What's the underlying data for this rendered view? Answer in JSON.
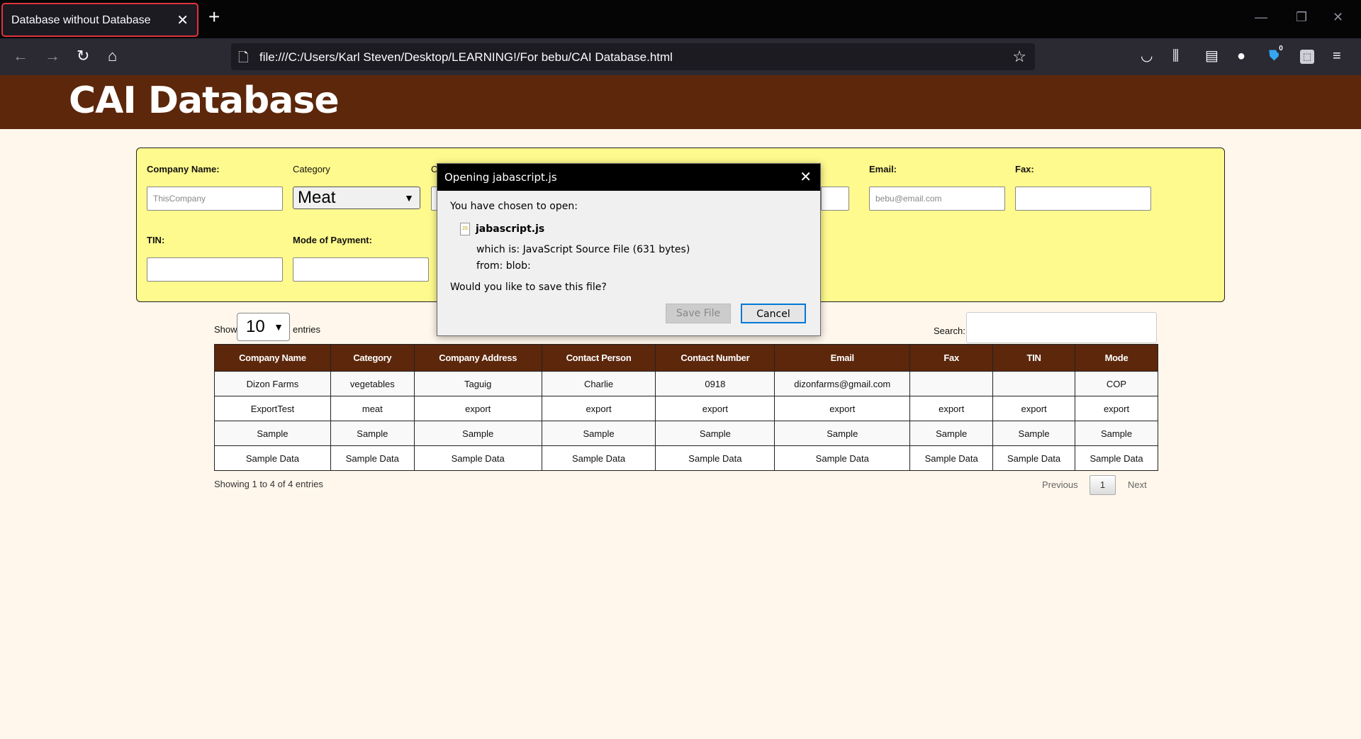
{
  "browser": {
    "tab_title": "Database without Database",
    "tab_close": "✕",
    "new_tab": "+",
    "url": "file:///C:/Users/Karl Steven/Desktop/LEARNING!/For bebu/CAI Database.html",
    "extension_badge": "0"
  },
  "page": {
    "title": "CAI Database"
  },
  "form": {
    "company_name_label": "Company Name:",
    "company_name_placeholder": "ThisCompany",
    "category_label": "Category",
    "category_value": "Meat",
    "partial_label": "C",
    "email_label": "Email:",
    "email_placeholder": "bebu@email.com",
    "fax_label": "Fax:",
    "tin_label": "TIN:",
    "mode_label": "Mode of Payment:"
  },
  "table_controls": {
    "show_label": "Show",
    "entries_value": "10",
    "entries_label": "entries",
    "search_label": "Search:"
  },
  "table": {
    "headers": [
      "Company Name",
      "Category",
      "Company Address",
      "Contact Person",
      "Contact Number",
      "Email",
      "Fax",
      "TIN",
      "Mode"
    ],
    "rows": [
      [
        "Dizon Farms",
        "vegetables",
        "Taguig",
        "Charlie",
        "0918",
        "dizonfarms@gmail.com",
        "",
        "",
        "COP"
      ],
      [
        "ExportTest",
        "meat",
        "export",
        "export",
        "export",
        "export",
        "export",
        "export",
        "export"
      ],
      [
        "Sample",
        "Sample",
        "Sample",
        "Sample",
        "Sample",
        "Sample",
        "Sample",
        "Sample",
        "Sample"
      ],
      [
        "Sample Data",
        "Sample Data",
        "Sample Data",
        "Sample Data",
        "Sample Data",
        "Sample Data",
        "Sample Data",
        "Sample Data",
        "Sample Data"
      ]
    ]
  },
  "pagination": {
    "info": "Showing 1 to 4 of 4 entries",
    "previous": "Previous",
    "page": "1",
    "next": "Next"
  },
  "dialog": {
    "title": "Opening jabascript.js",
    "intro": "You have chosen to open:",
    "file_name": "jabascript.js",
    "file_icon_label": "JS",
    "which_is": "which is:  JavaScript Source File (631 bytes)",
    "from": "from:  blob:",
    "question": "Would you like to save this file?",
    "save_button": "Save File",
    "cancel_button": "Cancel"
  }
}
